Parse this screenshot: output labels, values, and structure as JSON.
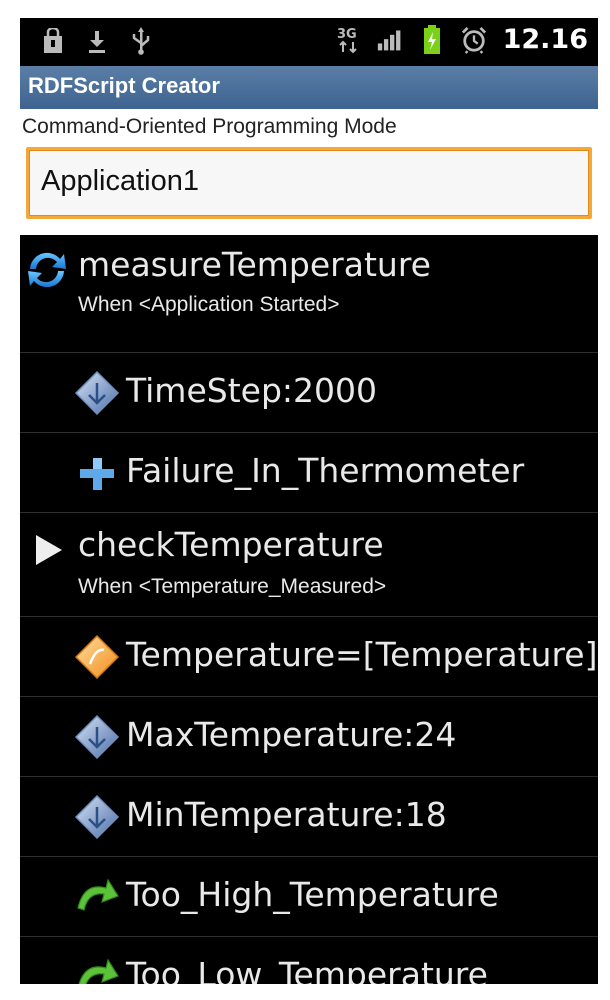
{
  "status_bar": {
    "time": "12.16",
    "network": "3G",
    "icons": [
      "shopping-bag-icon",
      "download-icon",
      "usb-icon",
      "3g-data-icon",
      "signal-icon",
      "battery-charging-icon",
      "alarm-icon"
    ],
    "colors": {
      "battery": "#7bd11a"
    }
  },
  "app": {
    "title": "RDFScript Creator",
    "title_bar_color": "#4a6f9c"
  },
  "mode": {
    "label": "Command-Oriented Programming Mode",
    "application_name": "Application1",
    "input_border_color": "#f4a83a"
  },
  "list": {
    "items": [
      {
        "icon": "refresh-icon",
        "label": "measureTemperature",
        "sublabel": "When <Application Started>"
      },
      {
        "icon": "diamond-blue-icon",
        "label": "TimeStep:2000"
      },
      {
        "icon": "plus-icon",
        "label": "Failure_In_Thermometer"
      },
      {
        "icon": "play-icon",
        "label": "checkTemperature",
        "sublabel": "When <Temperature_Measured>"
      },
      {
        "icon": "diamond-orange-icon",
        "label": "Temperature=[Temperature]"
      },
      {
        "icon": "diamond-blue-icon",
        "label": "MaxTemperature:24"
      },
      {
        "icon": "diamond-blue-icon",
        "label": "MinTemperature:18"
      },
      {
        "icon": "green-arrow-icon",
        "label": "Too_High_Temperature"
      },
      {
        "icon": "green-arrow-icon",
        "label": "Too_Low_Temperature"
      }
    ]
  }
}
